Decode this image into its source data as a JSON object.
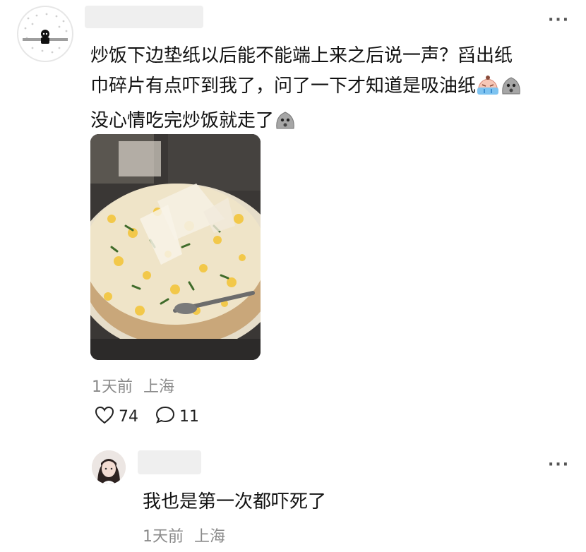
{
  "comment": {
    "text_line1": "炒饭下边垫纸以后能不能端上来之后说一声？舀出纸",
    "text_line2": "巾碎片有点吓到我了，问了一下才知道是吸油纸",
    "text_line3": "没心情吃完炒饭就走了",
    "time": "1天前",
    "location": "上海",
    "likes": "74",
    "replies": "11",
    "more_glyph": "···"
  },
  "reply": {
    "text": "我也是第一次都吓死了",
    "time": "1天前",
    "location": "上海",
    "more_glyph": "···"
  },
  "icons": {
    "emoji_crying": "crying-emoji-icon",
    "emoji_speechless": "speechless-emoji-icon",
    "like": "heart-icon",
    "reply": "chat-bubble-icon"
  }
}
